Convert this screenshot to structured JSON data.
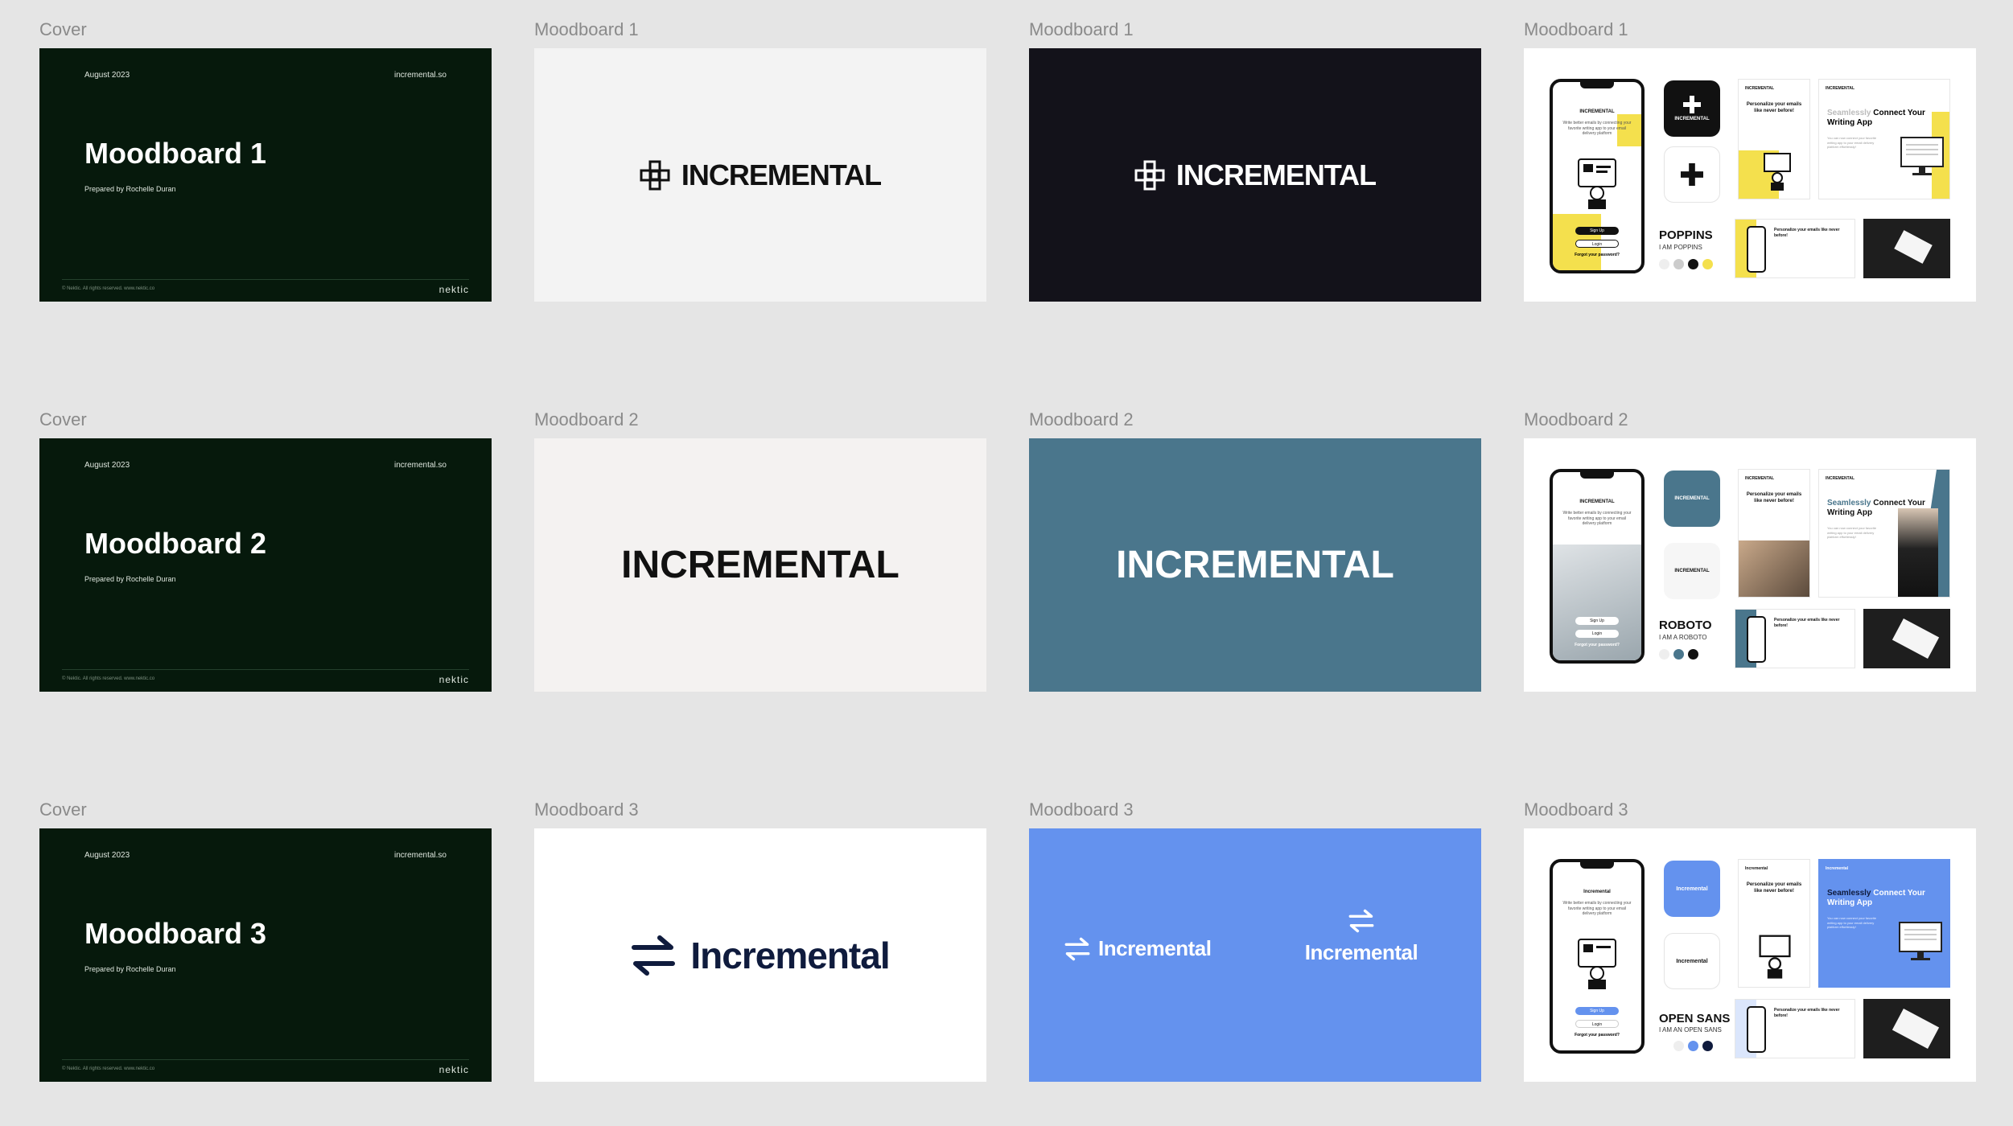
{
  "canvas": {
    "background": "#e5e5e5"
  },
  "cover_style": {
    "background": "#06190c",
    "brand": "nektic",
    "date": "August 2023",
    "site": "incremental.so",
    "prepared_by": "Prepared by Rochelle Duran",
    "copyright": "© Nektic. All rights reserved. www.nektic.co"
  },
  "rows": [
    {
      "cover": {
        "label": "Cover",
        "title": "Moodboard 1"
      },
      "logo_light": {
        "label": "Moodboard 1",
        "wordmark": "INCREMENTAL",
        "bg": "#f3f3f3",
        "fg": "#111111"
      },
      "logo_dark": {
        "label": "Moodboard 1",
        "wordmark": "INCREMENTAL",
        "bg": "#13121a",
        "fg": "#ffffff"
      },
      "detail": {
        "label": "Moodboard 1",
        "accent": "#f4e04d",
        "font_name": "POPPINS",
        "font_sample": "I AM POPPINS",
        "swatches": [
          "#eeeeee",
          "#cccccc",
          "#111111",
          "#f4e04d"
        ],
        "app_tile": "INCREMENTAL",
        "app_tile_icon": "plus-icon",
        "phone_title": "INCREMENTAL",
        "phone_text": "Write better emails by connecting your favorite writing app to your email delivery platform",
        "phone_buttons": [
          "Sign Up",
          "Login",
          "Forgot your password?"
        ],
        "card_small": "INCREMENTAL",
        "card_head_accent": "Seamlessly",
        "card_head_rest": "Connect Your Writing App",
        "card_mid": "Personalize your emails like never before!",
        "card_bottom": "Personalize your emails like never before!"
      }
    },
    {
      "cover": {
        "label": "Cover",
        "title": "Moodboard 2"
      },
      "logo_light": {
        "label": "Moodboard 2",
        "wordmark": "INCREMENTAL",
        "bg": "#f4f2f1",
        "fg": "#111111"
      },
      "logo_dark": {
        "label": "Moodboard 2",
        "wordmark": "INCREMENTAL",
        "bg": "#4a768c",
        "fg": "#ffffff"
      },
      "detail": {
        "label": "Moodboard 2",
        "accent": "#4a768c",
        "font_name": "ROBOTO",
        "font_sample": "I AM A ROBOTO",
        "swatches": [
          "#eeeeee",
          "#4a768c",
          "#111111"
        ],
        "app_tile": "INCREMENTAL",
        "phone_title": "INCREMENTAL",
        "phone_text": "Write better emails by connecting your favorite writing app to your email delivery platform",
        "phone_buttons": [
          "Sign Up",
          "Login",
          "Forgot your password?"
        ],
        "card_small": "INCREMENTAL",
        "card_head_accent": "Seamlessly",
        "card_head_rest": "Connect Your Writing App",
        "card_mid": "Personalize your emails like never before!",
        "card_bottom": "Personalize your emails like never before!"
      }
    },
    {
      "cover": {
        "label": "Cover",
        "title": "Moodboard 3"
      },
      "logo_light": {
        "label": "Moodboard 3",
        "wordmark": "Incremental",
        "bg": "#ffffff",
        "fg": "#0f1b3d"
      },
      "logo_dark": {
        "label": "Moodboard 3",
        "wordmark": "Incremental",
        "bg": "#6492ee",
        "fg": "#ffffff"
      },
      "detail": {
        "label": "Moodboard 3",
        "accent": "#6492ee",
        "font_name": "OPEN SANS",
        "font_sample": "I AM AN OPEN SANS",
        "swatches": [
          "#eeeeee",
          "#6492ee",
          "#0f1b3d"
        ],
        "app_tile": "Incremental",
        "phone_title": "Incremental",
        "phone_text": "Write better emails by connecting your favorite writing app to your email delivery platform",
        "phone_buttons": [
          "Sign Up",
          "Login",
          "Forgot your password?"
        ],
        "card_small": "Incremental",
        "card_head_accent": "Seamlessly",
        "card_head_rest": "Connect Your Writing App",
        "card_mid": "Personalize your emails like never before!",
        "card_bottom": "Personalize your emails like never before!"
      }
    }
  ]
}
